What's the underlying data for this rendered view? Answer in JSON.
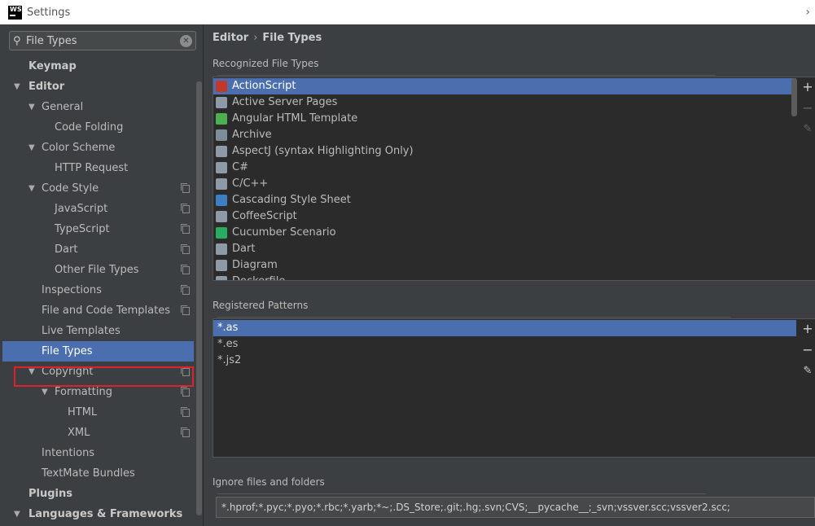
{
  "window": {
    "title": "Settings"
  },
  "search": {
    "value": "File Types"
  },
  "tree": [
    {
      "label": "Keymap",
      "level": 0,
      "bold": true,
      "arrow": "",
      "copy": false
    },
    {
      "label": "Editor",
      "level": 0,
      "bold": true,
      "arrow": "▼",
      "copy": false
    },
    {
      "label": "General",
      "level": 1,
      "arrow": "▼",
      "copy": false
    },
    {
      "label": "Code Folding",
      "level": 2,
      "arrow": "",
      "copy": false
    },
    {
      "label": "Color Scheme",
      "level": 1,
      "arrow": "▼",
      "copy": false
    },
    {
      "label": "HTTP Request",
      "level": 2,
      "arrow": "",
      "copy": false
    },
    {
      "label": "Code Style",
      "level": 1,
      "arrow": "▼",
      "copy": true
    },
    {
      "label": "JavaScript",
      "level": 2,
      "arrow": "",
      "copy": true
    },
    {
      "label": "TypeScript",
      "level": 2,
      "arrow": "",
      "copy": true
    },
    {
      "label": "Dart",
      "level": 2,
      "arrow": "",
      "copy": true
    },
    {
      "label": "Other File Types",
      "level": 2,
      "arrow": "",
      "copy": true
    },
    {
      "label": "Inspections",
      "level": 1,
      "arrow": "",
      "copy": true
    },
    {
      "label": "File and Code Templates",
      "level": 1,
      "arrow": "",
      "copy": true
    },
    {
      "label": "Live Templates",
      "level": 1,
      "arrow": "",
      "copy": false
    },
    {
      "label": "File Types",
      "level": 1,
      "arrow": "",
      "copy": false,
      "selected": true
    },
    {
      "label": "Copyright",
      "level": 1,
      "arrow": "▼",
      "copy": true
    },
    {
      "label": "Formatting",
      "level": 2,
      "arrow": "▼",
      "copy": true
    },
    {
      "label": "HTML",
      "level": 3,
      "arrow": "",
      "copy": true
    },
    {
      "label": "XML",
      "level": 3,
      "arrow": "",
      "copy": true
    },
    {
      "label": "Intentions",
      "level": 1,
      "arrow": "",
      "copy": false
    },
    {
      "label": "TextMate Bundles",
      "level": 1,
      "arrow": "",
      "copy": false
    },
    {
      "label": "Plugins",
      "level": 0,
      "bold": true,
      "arrow": "",
      "copy": false
    },
    {
      "label": "Languages & Frameworks",
      "level": 0,
      "bold": true,
      "arrow": "▼",
      "copy": false
    }
  ],
  "breadcrumb": {
    "parent": "Editor",
    "sep": "›",
    "current": "File Types"
  },
  "recognized": {
    "title": "Recognized File Types",
    "items": [
      {
        "label": "ActionScript",
        "icon": "actionscript-icon",
        "color": "#c0392b",
        "selected": true
      },
      {
        "label": "Active Server Pages",
        "icon": "asp-file-icon",
        "color": "#8e9aa6"
      },
      {
        "label": "Angular HTML Template",
        "icon": "angular-html-icon",
        "color": "#4caf50"
      },
      {
        "label": "Archive",
        "icon": "archive-icon",
        "color": "#7f8c99"
      },
      {
        "label": "AspectJ (syntax Highlighting Only)",
        "icon": "aspectj-file-icon",
        "color": "#8e9aa6"
      },
      {
        "label": "C#",
        "icon": "csharp-file-icon",
        "color": "#8e9aa6"
      },
      {
        "label": "C/C++",
        "icon": "cpp-file-icon",
        "color": "#8e9aa6"
      },
      {
        "label": "Cascading Style Sheet",
        "icon": "css-file-icon",
        "color": "#3b7fc4"
      },
      {
        "label": "CoffeeScript",
        "icon": "coffeescript-file-icon",
        "color": "#8e9aa6"
      },
      {
        "label": "Cucumber Scenario",
        "icon": "cucumber-icon",
        "color": "#27ae60"
      },
      {
        "label": "Dart",
        "icon": "dart-file-icon",
        "color": "#8e9aa6"
      },
      {
        "label": "Diagram",
        "icon": "diagram-icon",
        "color": "#8e9aa6"
      },
      {
        "label": "Dockerfile",
        "icon": "dockerfile-icon",
        "color": "#8e9aa6"
      }
    ]
  },
  "patterns": {
    "title": "Registered Patterns",
    "items": [
      {
        "label": "*.as",
        "selected": true
      },
      {
        "label": "*.es"
      },
      {
        "label": "*.js2"
      }
    ]
  },
  "ignore": {
    "title": "Ignore files and folders",
    "value": "*.hprof;*.pyc;*.pyo;*.rbc;*.yarb;*~;.DS_Store;.git;.hg;.svn;CVS;__pycache__;_svn;vssver.scc;vssver2.scc;"
  },
  "buttons": {
    "add": "+",
    "remove": "−",
    "edit": "✎"
  }
}
